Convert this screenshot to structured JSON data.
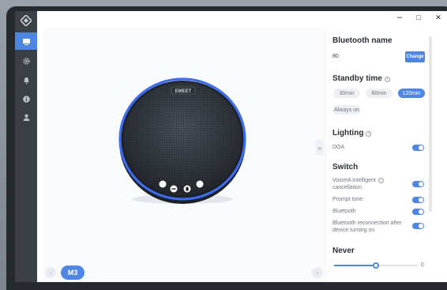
{
  "window": {
    "minimize": "–",
    "maximize": "□",
    "close": "✕"
  },
  "sidebar": {
    "items": [
      {
        "icon": "device-icon",
        "active": true
      },
      {
        "icon": "gear-icon",
        "active": false
      },
      {
        "icon": "bell-icon",
        "active": false
      },
      {
        "icon": "info-icon",
        "active": false
      },
      {
        "icon": "user-icon",
        "active": false
      }
    ]
  },
  "device": {
    "brand_label": "EMEET",
    "model": "M3",
    "prev_icon": "‹",
    "next_icon": "›",
    "collapse_icon": "»"
  },
  "settings": {
    "bluetooth": {
      "title": "Bluetooth name",
      "value": "80",
      "change_label": "Change"
    },
    "standby": {
      "title": "Standby time",
      "options": [
        "30min",
        "60min",
        "120min",
        "Always on"
      ],
      "selected": "120min"
    },
    "lighting": {
      "title": "Lighting",
      "doa_label": "DOA",
      "doa_on": true
    },
    "switch": {
      "title": "Switch",
      "items": [
        {
          "label_line1": "VoiceIA intelligent",
          "label_line2": "cancellation",
          "on": true
        },
        {
          "label": "Prompt tone",
          "on": true
        },
        {
          "label": "Bluetooth",
          "on": true
        },
        {
          "label_line1": "Bluetooth reconnection after",
          "label_line2": "device turning on",
          "on": true
        }
      ]
    },
    "never": {
      "title": "Never",
      "value": "0",
      "fraction": 0.5
    }
  },
  "colors": {
    "accent": "#4f86e3",
    "sidebar": "#3b3f46",
    "speaker_ring": "#3d6cf0",
    "speaker_body": "#2d3138"
  }
}
